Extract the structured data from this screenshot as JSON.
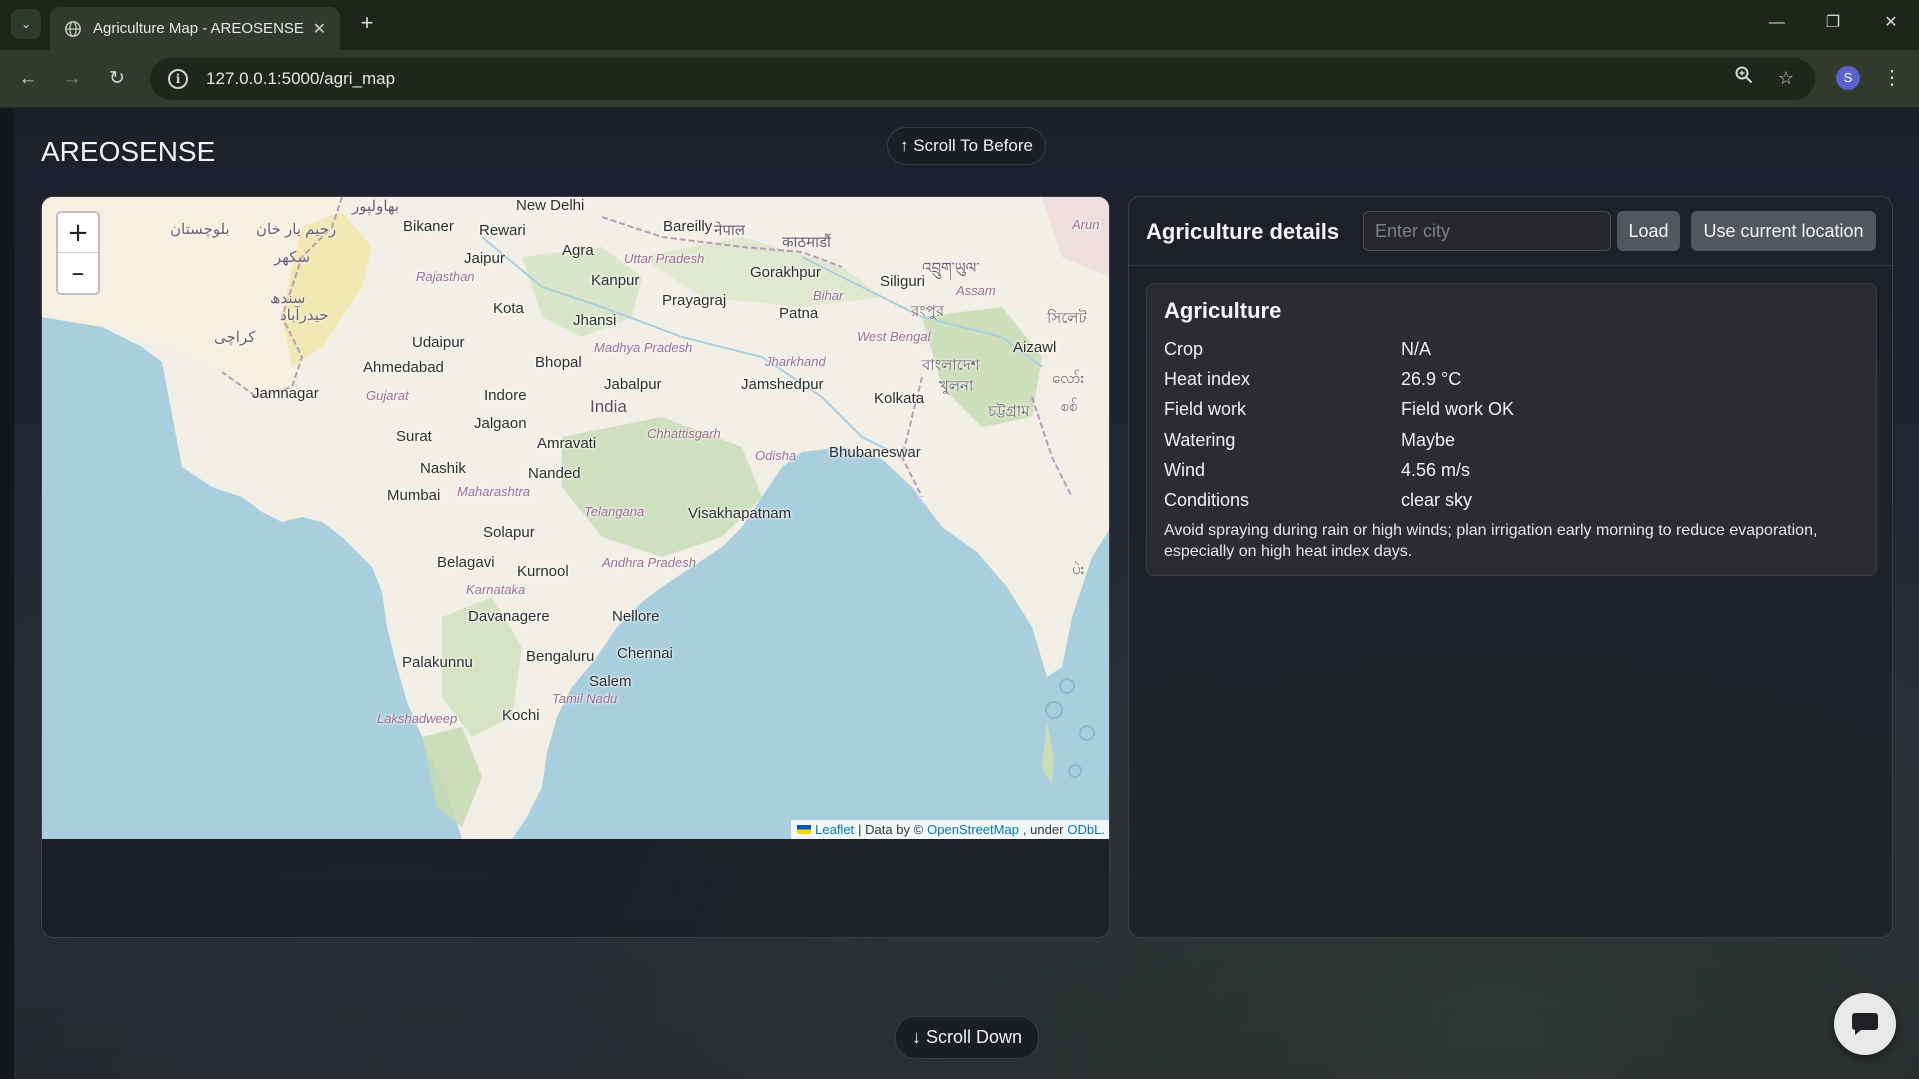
{
  "browser": {
    "tab_title": "Agriculture Map - AREOSENSE",
    "url": "127.0.0.1:5000/agri_map",
    "profile_initial": "S"
  },
  "page": {
    "brand": "AREOSENSE",
    "scroll_up_label": "↑ Scroll To Before",
    "scroll_down_label": "↓ Scroll Down"
  },
  "map": {
    "zoom_in": "+",
    "zoom_out": "–",
    "attribution": {
      "leaflet": "Leaflet",
      "data_by": "| Data by ©",
      "osm": "OpenStreetMap",
      "under": ", under",
      "odbl": "ODbL."
    },
    "labels": [
      {
        "text": "New Delhi",
        "kind": "city"
      },
      {
        "text": "Bareilly",
        "kind": "city"
      },
      {
        "text": "Bikaner",
        "kind": "city"
      },
      {
        "text": "Rewari",
        "kind": "city"
      },
      {
        "text": "Jaipur",
        "kind": "city"
      },
      {
        "text": "Agra",
        "kind": "city"
      },
      {
        "text": "Kanpur",
        "kind": "city"
      },
      {
        "text": "Gorakhpur",
        "kind": "city"
      },
      {
        "text": "Siliguri",
        "kind": "city"
      },
      {
        "text": "Prayagraj",
        "kind": "city"
      },
      {
        "text": "Kota",
        "kind": "city"
      },
      {
        "text": "Jhansi",
        "kind": "city"
      },
      {
        "text": "Patna",
        "kind": "city"
      },
      {
        "text": "Udaipur",
        "kind": "city"
      },
      {
        "text": "Ahmedabad",
        "kind": "city"
      },
      {
        "text": "Bhopal",
        "kind": "city"
      },
      {
        "text": "Jabalpur",
        "kind": "city"
      },
      {
        "text": "Jamshedpur",
        "kind": "city"
      },
      {
        "text": "Kolkata",
        "kind": "city"
      },
      {
        "text": "Jamnagar",
        "kind": "city"
      },
      {
        "text": "Indore",
        "kind": "city"
      },
      {
        "text": "Aizawl",
        "kind": "city"
      },
      {
        "text": "Jalgaon",
        "kind": "city"
      },
      {
        "text": "Surat",
        "kind": "city"
      },
      {
        "text": "Amravati",
        "kind": "city"
      },
      {
        "text": "Bhubaneswar",
        "kind": "city"
      },
      {
        "text": "Nashik",
        "kind": "city"
      },
      {
        "text": "Nanded",
        "kind": "city"
      },
      {
        "text": "Mumbai",
        "kind": "city"
      },
      {
        "text": "Visakhapatnam",
        "kind": "city"
      },
      {
        "text": "Solapur",
        "kind": "city"
      },
      {
        "text": "Belagavi",
        "kind": "city"
      },
      {
        "text": "Kurnool",
        "kind": "city"
      },
      {
        "text": "Davanagere",
        "kind": "city"
      },
      {
        "text": "Nellore",
        "kind": "city"
      },
      {
        "text": "Palakunnu",
        "kind": "city"
      },
      {
        "text": "Bengaluru",
        "kind": "city"
      },
      {
        "text": "Chennai",
        "kind": "city"
      },
      {
        "text": "Salem",
        "kind": "city"
      },
      {
        "text": "Kochi",
        "kind": "city"
      },
      {
        "text": "India",
        "kind": "country"
      },
      {
        "text": "Rajasthan",
        "kind": "state"
      },
      {
        "text": "Uttar Pradesh",
        "kind": "state"
      },
      {
        "text": "Bihar",
        "kind": "state"
      },
      {
        "text": "Assam",
        "kind": "state"
      },
      {
        "text": "West Bengal",
        "kind": "state"
      },
      {
        "text": "Madhya Pradesh",
        "kind": "state"
      },
      {
        "text": "Jharkhand",
        "kind": "state"
      },
      {
        "text": "Gujarat",
        "kind": "state"
      },
      {
        "text": "Chhattisgarh",
        "kind": "state"
      },
      {
        "text": "Odisha",
        "kind": "state"
      },
      {
        "text": "Maharashtra",
        "kind": "state"
      },
      {
        "text": "Telangana",
        "kind": "state"
      },
      {
        "text": "Andhra Pradesh",
        "kind": "state"
      },
      {
        "text": "Karnataka",
        "kind": "state"
      },
      {
        "text": "Tamil Nadu",
        "kind": "state"
      },
      {
        "text": "Lakshadweep",
        "kind": "state"
      },
      {
        "text": "بھاولپور",
        "kind": "foreign"
      },
      {
        "text": "بلوچستان",
        "kind": "foreign"
      },
      {
        "text": "رحیم یار خان",
        "kind": "foreign"
      },
      {
        "text": "سکھر",
        "kind": "foreign"
      },
      {
        "text": "سندھ",
        "kind": "foreign"
      },
      {
        "text": "حیدرآباد",
        "kind": "foreign"
      },
      {
        "text": "کراچی",
        "kind": "foreign"
      },
      {
        "text": "नेपाल",
        "kind": "foreign"
      },
      {
        "text": "काठमाडौं",
        "kind": "foreign"
      },
      {
        "text": "འབྲུག་ཡུལ་",
        "kind": "foreign"
      },
      {
        "text": "রংপুর",
        "kind": "foreign"
      },
      {
        "text": "সিলেট",
        "kind": "foreign"
      },
      {
        "text": "বাংলাদেশ",
        "kind": "foreign"
      },
      {
        "text": "খুলনা",
        "kind": "foreign"
      },
      {
        "text": "চট্টগ্রাম",
        "kind": "foreign"
      },
      {
        "text": "လော်း",
        "kind": "foreign"
      },
      {
        "text": "စစ်",
        "kind": "foreign"
      },
      {
        "text": "ပဲး",
        "kind": "foreign"
      },
      {
        "text": "Arun",
        "kind": "state"
      }
    ]
  },
  "agri": {
    "title": "Agriculture details",
    "city_placeholder": "Enter city",
    "load_label": "Load",
    "location_label": "Use current location",
    "panel_title": "Agriculture",
    "rows": [
      {
        "key": "Crop",
        "value": "N/A"
      },
      {
        "key": "Heat index",
        "value": "26.9 °C"
      },
      {
        "key": "Field work",
        "value": "Field work OK"
      },
      {
        "key": "Watering",
        "value": "Maybe"
      },
      {
        "key": "Wind",
        "value": "4.56 m/s"
      },
      {
        "key": "Conditions",
        "value": "clear sky"
      }
    ],
    "advice": "Avoid spraying during rain or high winds; plan irrigation early morning to reduce evaporation, especially on high heat index days."
  }
}
